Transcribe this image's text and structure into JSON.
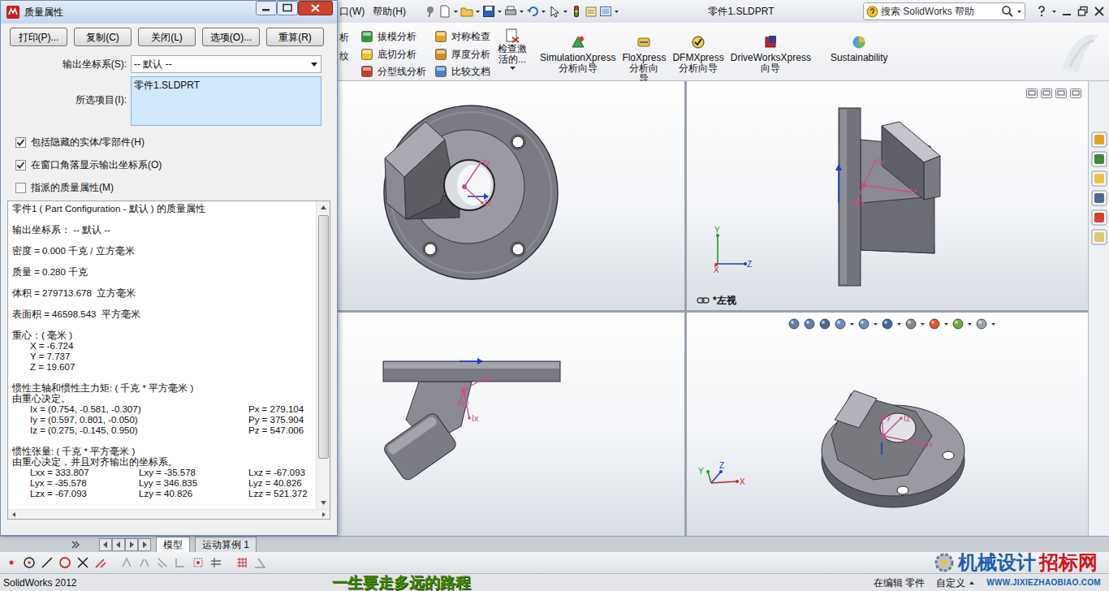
{
  "dialog": {
    "title": "质量属性",
    "buttons": [
      "打印(P)...",
      "复制(C)",
      "关闭(L)",
      "选项(O)...",
      "重算(R)"
    ],
    "coord_label": "输出坐标系(S):",
    "coord_value": "-- 默认 --",
    "selection_label": "所选项目(I):",
    "selection_items": [
      "零件1.SLDPRT"
    ],
    "options": [
      {
        "label": "包括隐藏的实体/零部件(H)",
        "checked": true
      },
      {
        "label": "在窗口角落显示输出坐标系(O)",
        "checked": true
      },
      {
        "label": "指派的质量属性(M)",
        "checked": false
      }
    ],
    "results": [
      [
        {
          "kind": "plain",
          "cells": [
            "零件1 ( Part Configuration - 默认 ) 的质量属性"
          ]
        }
      ],
      [
        {
          "kind": "plain",
          "cells": [
            "输出坐标系： -- 默认 --"
          ]
        }
      ],
      [
        {
          "kind": "plain",
          "cells": [
            "密度 = 0.000 千克 / 立方毫米"
          ]
        }
      ],
      [
        {
          "kind": "plain",
          "cells": [
            "质量 = 0.280 千克"
          ]
        }
      ],
      [
        {
          "kind": "plain",
          "cells": [
            "体积 = 279713.678  立方毫米"
          ]
        }
      ],
      [
        {
          "kind": "plain",
          "cells": [
            "表面积 = 46598.543  平方毫米"
          ]
        }
      ],
      [
        {
          "kind": "plain",
          "cells": [
            "重心：( 毫米 )"
          ]
        },
        {
          "kind": "indent",
          "cells": [
            "X = -6.724"
          ]
        },
        {
          "kind": "indent",
          "cells": [
            "Y = 7.737"
          ]
        },
        {
          "kind": "indent",
          "cells": [
            "Z = 19.607"
          ]
        }
      ],
      [
        {
          "kind": "plain",
          "cells": [
            "惯性主轴和惯性主力矩: ( 千克 * 平方毫米 )"
          ]
        },
        {
          "kind": "plain",
          "cells": [
            "由重心决定。"
          ]
        },
        {
          "kind": "pair",
          "cells": [
            "Ix = (0.754, -0.581, -0.307)",
            "Px = 279.104"
          ]
        },
        {
          "kind": "pair",
          "cells": [
            "Iy = (0.597, 0.801, -0.050)",
            "Py = 375.904"
          ]
        },
        {
          "kind": "pair",
          "cells": [
            "Iz = (0.275, -0.145, 0.950)",
            "Pz = 547.006"
          ]
        }
      ],
      [
        {
          "kind": "plain",
          "cells": [
            "惯性张量: ( 千克 * 平方毫米 )"
          ]
        },
        {
          "kind": "plain",
          "cells": [
            "由重心决定，并且对齐输出的坐标系。"
          ]
        },
        {
          "kind": "triple",
          "cells": [
            "Lxx = 333.807",
            "Lxy = -35.578",
            "Lxz = -67.093"
          ]
        },
        {
          "kind": "triple",
          "cells": [
            "Lyx = -35.578",
            "Lyy = 346.835",
            "Lyz = 40.826"
          ]
        },
        {
          "kind": "triple",
          "cells": [
            "Lzx = -67.093",
            "Lzy = 40.826",
            "Lzz = 521.372"
          ]
        }
      ]
    ]
  },
  "menubar": {
    "menus": [
      "口(W)",
      "帮助(H)"
    ],
    "title": "零件1.SLDPRT",
    "search": {
      "placeholder": "搜索 SolidWorks 帮助"
    }
  },
  "ribbon": {
    "cut_items": [
      "析",
      "纹"
    ],
    "small_groups": [
      [
        "拔模分析",
        "底切分析",
        "分型线分析"
      ],
      [
        "对称检查",
        "厚度分析",
        "比较文档"
      ]
    ],
    "check_button": {
      "lines": [
        "检查激",
        "活的..."
      ]
    },
    "big_buttons": [
      {
        "lines": [
          "SimulationXpress",
          "分析向导"
        ]
      },
      {
        "lines": [
          "FloXpress",
          "分析向",
          "导"
        ]
      },
      {
        "lines": [
          "DFMXpress",
          "分析向导"
        ]
      },
      {
        "lines": [
          "DriveWorksXpress",
          "向导"
        ]
      },
      {
        "lines": [
          "Sustainability"
        ]
      }
    ]
  },
  "viewports": [
    {
      "axes": [
        "Iy",
        "Ix"
      ],
      "triad": [],
      "label": ""
    },
    {
      "axes": [
        "Iy",
        "Iz",
        "Ix"
      ],
      "triad": [
        {
          "text": "Y",
          "color": "#1e9e1e"
        },
        {
          "text": "Z",
          "color": "#1c3fd0"
        },
        {
          "text": "X",
          "color": "#d02020"
        }
      ],
      "label": "*左视"
    },
    {
      "axes": [
        "Iz",
        "Iy",
        "Ix"
      ],
      "triad": [],
      "label": ""
    },
    {
      "axes": [
        "Iy",
        "Iz",
        "Ix"
      ],
      "triad": [
        {
          "text": "Y",
          "color": "#1e9e1e"
        },
        {
          "text": "Z",
          "color": "#1c3fd0"
        },
        {
          "text": "X",
          "color": "#d02020"
        }
      ],
      "label": ""
    }
  ],
  "bottom_tabs": [
    {
      "label": "模型",
      "selected": true
    },
    {
      "label": "运动算例 1",
      "selected": false
    }
  ],
  "status_bar": {
    "app": "SolidWorks 2012",
    "slogan": "一生要走多远的路程",
    "mode": "在编辑 零件",
    "custom": "自定义"
  },
  "watermark": {
    "parts": [
      {
        "text": "机械设计",
        "color": "#1c5fb0"
      },
      {
        "text": "招标网",
        "color": "#d4141c"
      }
    ],
    "url": "WWW.JIXIEZHAOBIAO.COM"
  }
}
